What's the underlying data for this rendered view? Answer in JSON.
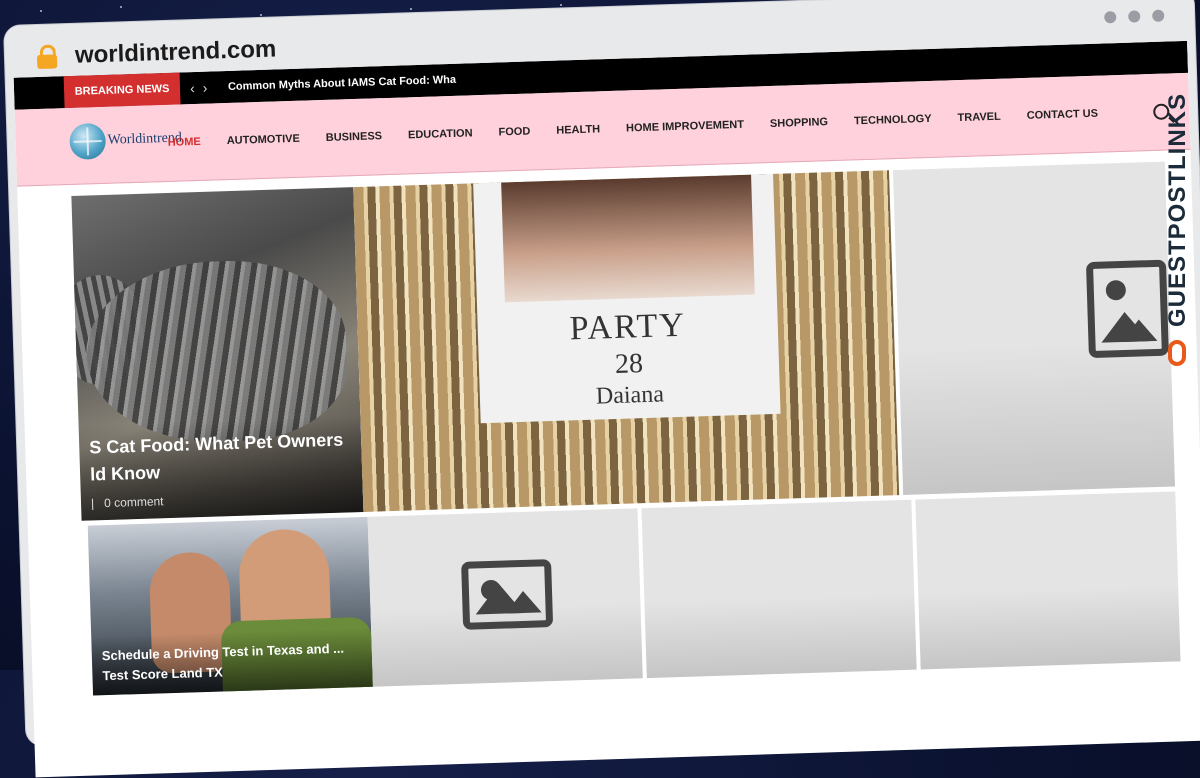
{
  "browser": {
    "url": "worldintrend.com"
  },
  "breaking": {
    "label": "BREAKING NEWS",
    "prev_icon": "chevron-left-icon",
    "next_icon": "chevron-right-icon",
    "headline": "Common Myths About IAMS Cat Food: Wha"
  },
  "header": {
    "logo_text": "Worldintrend",
    "nav": [
      "HOME",
      "AUTOMOTIVE",
      "BUSINESS",
      "EDUCATION",
      "FOOD",
      "HEALTH",
      "HOME IMPROVEMENT",
      "SHOPPING",
      "TECHNOLOGY",
      "TRAVEL",
      "CONTACT US"
    ],
    "search_icon": "search-icon"
  },
  "cards": {
    "cat": {
      "title": "S Cat Food: What Pet Owners ld Know",
      "meta_sep": "|",
      "comments": "0 comment"
    },
    "party": {
      "sign_line1": "PARTY",
      "sign_line2": "28",
      "sign_line3": "Daiana"
    },
    "driving": {
      "title": "Schedule a Driving Test in Texas and ... Test Score Land TX"
    }
  },
  "watermark": {
    "text": "GUESTPOSTLINKS"
  },
  "colors": {
    "accent": "#d32f2f",
    "header_bg": "#ffd1dc",
    "breaking_bg": "#000000",
    "watermark_icon": "#e8591a"
  }
}
